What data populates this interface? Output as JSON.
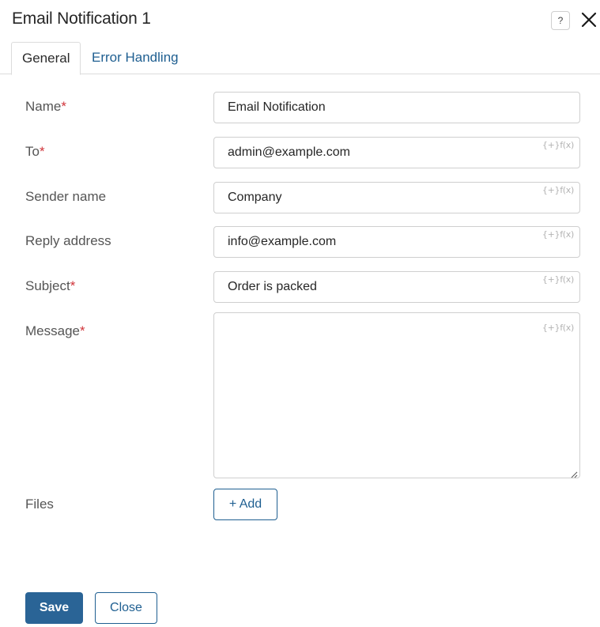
{
  "dialog": {
    "title": "Email Notification 1",
    "help_glyph": "?",
    "close_icon": "close-icon"
  },
  "tabs": [
    {
      "label": "General",
      "active": true
    },
    {
      "label": "Error Handling",
      "active": false
    }
  ],
  "form": {
    "required_mark": "*",
    "variable_hint": "{+}f(x)",
    "name": {
      "label": "Name",
      "value": "Email Notification"
    },
    "to": {
      "label": "To",
      "value": "admin@example.com"
    },
    "sender_name": {
      "label": "Sender name",
      "value": "Company"
    },
    "reply_address": {
      "label": "Reply address",
      "value": "info@example.com"
    },
    "subject": {
      "label": "Subject",
      "value": "Order is packed"
    },
    "message": {
      "label": "Message",
      "value": ""
    },
    "files": {
      "label": "Files",
      "add_label": "+ Add"
    }
  },
  "footer": {
    "save_label": "Save",
    "close_label": "Close"
  },
  "colors": {
    "accent": "#1f5f91",
    "primary_button": "#2a6496",
    "required": "#d0343a"
  }
}
